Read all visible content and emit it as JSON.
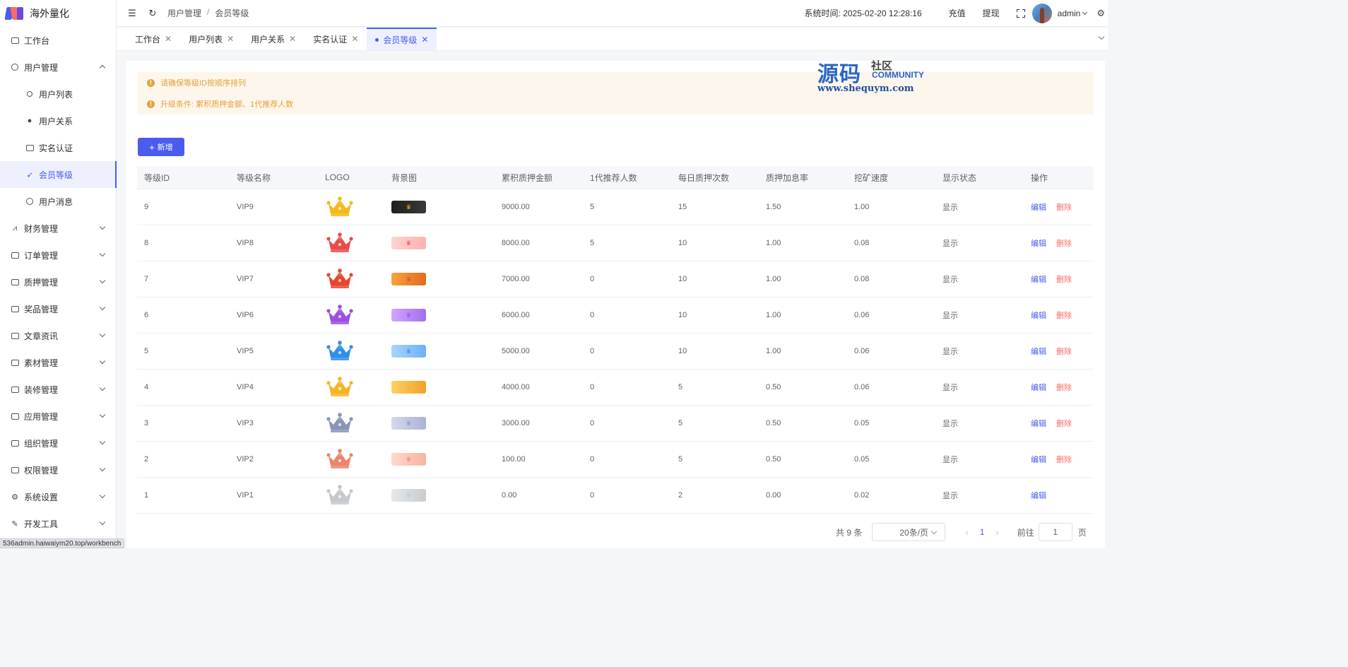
{
  "app": {
    "name": "海外量化"
  },
  "sidebar": {
    "items": [
      {
        "label": "工作台",
        "icon": "monitor-icon"
      },
      {
        "label": "用户管理",
        "icon": "user-icon",
        "expanded": true
      },
      {
        "label": "用户列表",
        "icon": "user-outline-icon",
        "sub": true
      },
      {
        "label": "用户关系",
        "icon": "users-icon",
        "sub": true
      },
      {
        "label": "实名认证",
        "icon": "id-card-icon",
        "sub": true
      },
      {
        "label": "会员等级",
        "icon": "rocket-icon",
        "sub": true,
        "active": true
      },
      {
        "label": "用户消息",
        "icon": "chat-icon",
        "sub": true
      },
      {
        "label": "财务管理",
        "icon": "chart-icon"
      },
      {
        "label": "订单管理",
        "icon": "order-icon"
      },
      {
        "label": "质押管理",
        "icon": "stack-icon"
      },
      {
        "label": "奖品管理",
        "icon": "bag-icon"
      },
      {
        "label": "文章资讯",
        "icon": "message-icon"
      },
      {
        "label": "素材管理",
        "icon": "image-icon"
      },
      {
        "label": "装修管理",
        "icon": "paint-icon"
      },
      {
        "label": "应用管理",
        "icon": "app-icon"
      },
      {
        "label": "组织管理",
        "icon": "building-icon"
      },
      {
        "label": "权限管理",
        "icon": "lock-icon"
      },
      {
        "label": "系统设置",
        "icon": "gear-icon"
      },
      {
        "label": "开发工具",
        "icon": "pen-icon"
      }
    ]
  },
  "header": {
    "breadcrumb": [
      "用户管理",
      "会员等级"
    ],
    "breadcrumb_sep": "/",
    "system_time_label": "系统时间:",
    "system_time": "2025-02-20 12:28:16",
    "recharge": "充值",
    "withdraw": "提现",
    "user": "admin"
  },
  "tabs": [
    {
      "label": "工作台"
    },
    {
      "label": "用户列表"
    },
    {
      "label": "用户关系"
    },
    {
      "label": "实名认证"
    },
    {
      "label": "会员等级",
      "active": true
    }
  ],
  "alerts": [
    "请确保等级ID按顺序排列",
    "升级条件: 累积质押金额、1代推荐人数"
  ],
  "watermark": {
    "big": "源码",
    "small1": "社区",
    "small2": "COMMUNITY",
    "url": "www.shequym.com"
  },
  "toolbar": {
    "add_label": "新增",
    "add_icon": "+"
  },
  "table": {
    "headers": [
      "等级ID",
      "等级名称",
      "LOGO",
      "背景图",
      "累积质押金额",
      "1代推荐人数",
      "每日质押次数",
      "质押加息率",
      "挖矿速度",
      "显示状态",
      "操作"
    ],
    "edit_label": "编辑",
    "delete_label": "删除",
    "rows": [
      {
        "id": "9",
        "name": "VIP9",
        "amount": "9000.00",
        "referrals": "5",
        "daily": "15",
        "rate": "1.50",
        "speed": "1.00",
        "status": "显示",
        "deletable": true,
        "crown": "#f5b818",
        "bg": [
          "#1e1e1e",
          "#3a3a3a"
        ]
      },
      {
        "id": "8",
        "name": "VIP8",
        "amount": "8000.00",
        "referrals": "5",
        "daily": "10",
        "rate": "1.00",
        "speed": "0.08",
        "status": "显示",
        "deletable": true,
        "crown": "#e94a4a",
        "bg": [
          "#ffd3d3",
          "#ffb0b0"
        ]
      },
      {
        "id": "7",
        "name": "VIP7",
        "amount": "7000.00",
        "referrals": "0",
        "daily": "10",
        "rate": "1.00",
        "speed": "0.08",
        "status": "显示",
        "deletable": true,
        "crown": "#e8452e",
        "bg": [
          "#f7a23c",
          "#e36a1e"
        ]
      },
      {
        "id": "6",
        "name": "VIP6",
        "amount": "6000.00",
        "referrals": "0",
        "daily": "10",
        "rate": "1.00",
        "speed": "0.06",
        "status": "显示",
        "deletable": true,
        "crown": "#9a4fe0",
        "bg": [
          "#cfa6ff",
          "#a46df2"
        ]
      },
      {
        "id": "5",
        "name": "VIP5",
        "amount": "5000.00",
        "referrals": "0",
        "daily": "10",
        "rate": "1.00",
        "speed": "0.06",
        "status": "显示",
        "deletable": true,
        "crown": "#2f8fe8",
        "bg": [
          "#a9d4ff",
          "#6fb0f5"
        ]
      },
      {
        "id": "4",
        "name": "VIP4",
        "amount": "4000.00",
        "referrals": "0",
        "daily": "5",
        "rate": "0.50",
        "speed": "0.06",
        "status": "显示",
        "deletable": true,
        "crown": "#f3b622",
        "bg": [
          "#ffd066",
          "#f0a22a"
        ]
      },
      {
        "id": "3",
        "name": "VIP3",
        "amount": "3000.00",
        "referrals": "0",
        "daily": "5",
        "rate": "0.50",
        "speed": "0.05",
        "status": "显示",
        "deletable": true,
        "crown": "#8a94b8",
        "bg": [
          "#d4d9ec",
          "#aab3d4"
        ]
      },
      {
        "id": "2",
        "name": "VIP2",
        "amount": "100.00",
        "referrals": "0",
        "daily": "5",
        "rate": "0.50",
        "speed": "0.05",
        "status": "显示",
        "deletable": true,
        "crown": "#e8856a",
        "bg": [
          "#ffd8cc",
          "#f8b4a0"
        ]
      },
      {
        "id": "1",
        "name": "VIP1",
        "amount": "0.00",
        "referrals": "0",
        "daily": "2",
        "rate": "0.00",
        "speed": "0.02",
        "status": "显示",
        "deletable": false,
        "crown": "#c4c8cc",
        "bg": [
          "#e6e8ea",
          "#c8ccd0"
        ]
      }
    ]
  },
  "pagination": {
    "total": "共 9 条",
    "page_size": "20条/页",
    "current_page": "1",
    "goto_label": "前往",
    "goto_value": "1",
    "page_unit": "页"
  },
  "statusbar": {
    "url": "536admin.haiwaiym20.top/workbench"
  },
  "colors": {
    "accent": "#4a5cf0",
    "danger": "#f56c6c",
    "warning": "#e6a23c"
  }
}
